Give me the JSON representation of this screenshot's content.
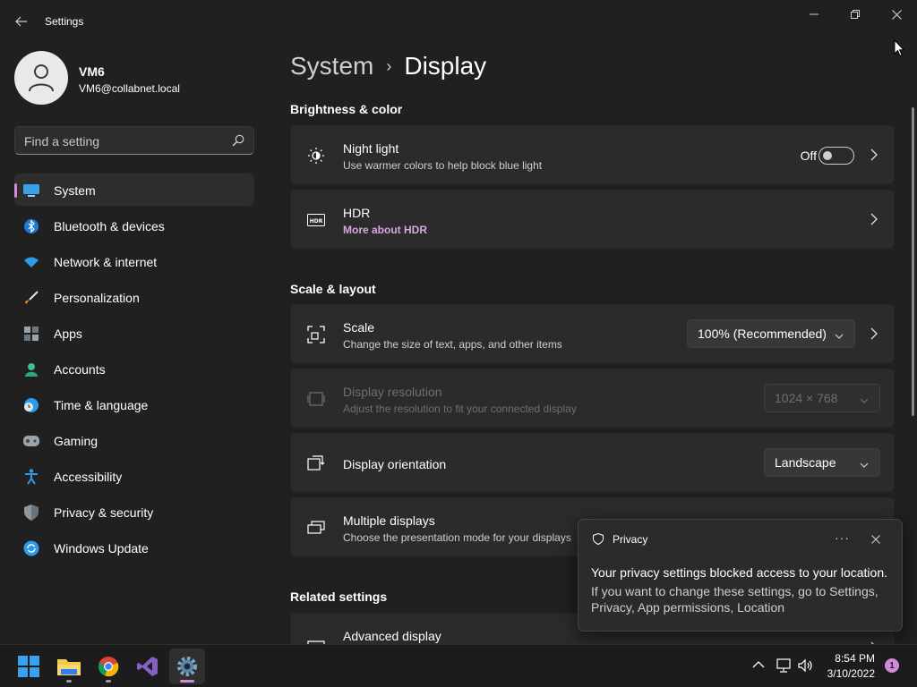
{
  "window": {
    "title": "Settings",
    "controls": [
      "minimize",
      "maximize",
      "close"
    ]
  },
  "user": {
    "name": "VM6",
    "email": "VM6@collabnet.local"
  },
  "search": {
    "placeholder": "Find a setting",
    "value": ""
  },
  "sidebar": {
    "items": [
      {
        "label": "System",
        "icon": "monitor-icon",
        "selected": true
      },
      {
        "label": "Bluetooth & devices",
        "icon": "bluetooth-icon"
      },
      {
        "label": "Network & internet",
        "icon": "wifi-icon"
      },
      {
        "label": "Personalization",
        "icon": "brush-icon"
      },
      {
        "label": "Apps",
        "icon": "apps-icon"
      },
      {
        "label": "Accounts",
        "icon": "person-icon"
      },
      {
        "label": "Time & language",
        "icon": "globe-clock-icon"
      },
      {
        "label": "Gaming",
        "icon": "gamepad-icon"
      },
      {
        "label": "Accessibility",
        "icon": "accessibility-icon"
      },
      {
        "label": "Privacy & security",
        "icon": "shield-icon"
      },
      {
        "label": "Windows Update",
        "icon": "update-icon"
      }
    ]
  },
  "breadcrumb": {
    "parent": "System",
    "separator": "›",
    "current": "Display"
  },
  "sections": {
    "brightness": "Brightness & color",
    "scale": "Scale & layout",
    "related": "Related settings"
  },
  "cards": {
    "night_light": {
      "title": "Night light",
      "subtitle": "Use warmer colors to help block blue light",
      "state": "Off"
    },
    "hdr": {
      "title": "HDR",
      "link": "More about HDR"
    },
    "scale": {
      "title": "Scale",
      "subtitle": "Change the size of text, apps, and other items",
      "value": "100% (Recommended)"
    },
    "resolution": {
      "title": "Display resolution",
      "subtitle": "Adjust the resolution to fit your connected display",
      "value": "1024 × 768"
    },
    "orientation": {
      "title": "Display orientation",
      "value": "Landscape"
    },
    "multiple": {
      "title": "Multiple displays",
      "subtitle": "Choose the presentation mode for your displays"
    },
    "advanced": {
      "title": "Advanced display"
    }
  },
  "toast": {
    "title": "Privacy",
    "more": "···",
    "body_line1": "Your privacy settings blocked access to your location.",
    "body_line2": "If you want to change these settings, go to Settings, Privacy, App permissions, Location"
  },
  "taskbar": {
    "apps": [
      "start-icon",
      "file-explorer-icon",
      "chrome-icon",
      "visual-studio-icon",
      "settings-icon"
    ],
    "time": "8:54 PM",
    "date": "3/10/2022",
    "notifications": "1"
  },
  "colors": {
    "accent": "#d08ad8",
    "background": "#202020",
    "card": "#2b2b2b",
    "link": "#d8a6e0"
  }
}
